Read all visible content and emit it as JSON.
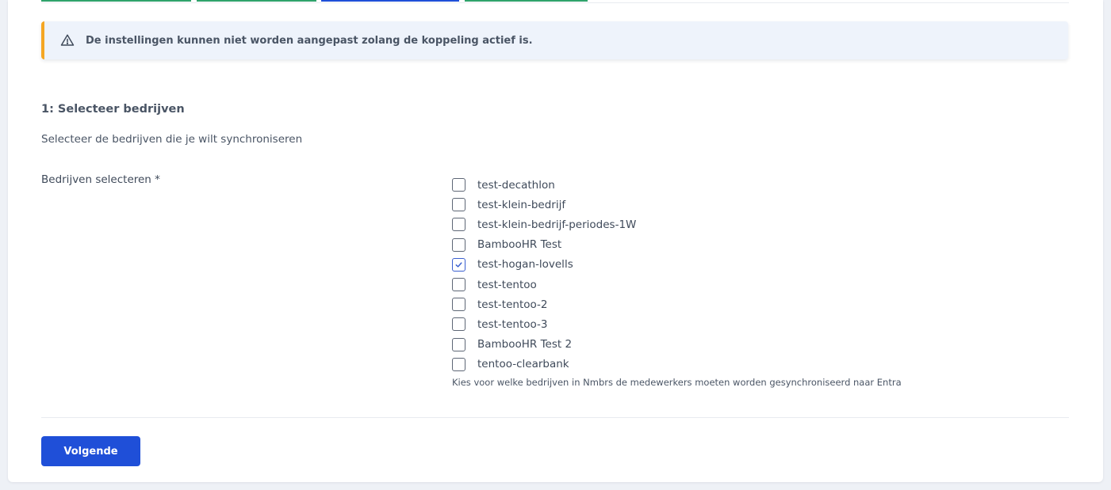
{
  "alert": {
    "icon": "warning-triangle-icon",
    "accent_color": "#f5a623",
    "text": "De instellingen kunnen niet worden aangepast zolang de koppeling actief is."
  },
  "section": {
    "title": "1: Selecteer bedrijven",
    "description": "Selecteer de bedrijven die je wilt synchroniseren"
  },
  "field": {
    "label": "Bedrijven selecteren *",
    "options": [
      {
        "label": "test-decathlon",
        "checked": false
      },
      {
        "label": "test-klein-bedrijf",
        "checked": false
      },
      {
        "label": "test-klein-bedrijf-periodes-1W",
        "checked": false
      },
      {
        "label": "BambooHR Test",
        "checked": false
      },
      {
        "label": "test-hogan-lovells",
        "checked": true
      },
      {
        "label": "test-tentoo",
        "checked": false
      },
      {
        "label": "test-tentoo-2",
        "checked": false
      },
      {
        "label": "test-tentoo-3",
        "checked": false
      },
      {
        "label": "BambooHR Test 2",
        "checked": false
      },
      {
        "label": "tentoo-clearbank",
        "checked": false
      }
    ],
    "help": "Kies voor welke bedrijven in Nmbrs de medewerkers moeten worden gesynchroniseerd naar Entra"
  },
  "actions": {
    "next_label": "Volgende",
    "primary_color": "#1f4fd8"
  }
}
